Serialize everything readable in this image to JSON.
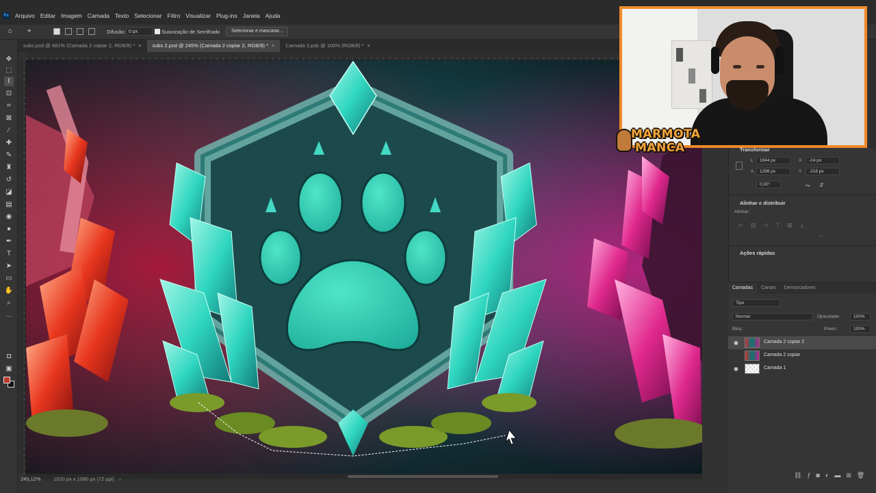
{
  "menu": [
    "Arquivo",
    "Editar",
    "Imagem",
    "Camada",
    "Texto",
    "Selecionar",
    "Filtro",
    "Visualizar",
    "Plug-ins",
    "Janela",
    "Ajuda"
  ],
  "options_bar": {
    "feather_label": "Difusão:",
    "feather_value": "0 px",
    "antialias_label": "Suavização de Serrilhado",
    "select_mask_button": "Selecionar e mascarar..."
  },
  "tabs": [
    {
      "label": "subs.psd @ 481% (Camada 2 copiar 2, RGB/8) *",
      "active": false
    },
    {
      "label": "subs 2.psd @ 245% (Camada 2 copiar 2, RGB/8) *",
      "active": true
    },
    {
      "label": "Camada 2.psb @ 100% (RGB/8) *",
      "active": false
    }
  ],
  "status": {
    "zoom": "245,12%",
    "dims": "1920 px x 1080 px (72 ppi)",
    "arrow": "›"
  },
  "brand": {
    "line1": "MARMOTA",
    "line2": "MANCA"
  },
  "properties": {
    "section_transform": "Transformar",
    "w_label": "L",
    "w_value": "1944 px",
    "h_label": "A",
    "h_value": "1296 px",
    "x_label": "X",
    "x_value": "-24 px",
    "y_label": "Y",
    "y_value": "-216 px",
    "angle_value": "0,00°",
    "section_align": "Alinhar e distribuir",
    "align_label": "Alinhar:",
    "more": "...",
    "section_quick": "Ações rápidas"
  },
  "layers_panel": {
    "tabs": [
      "Camadas",
      "Canais",
      "Demarcadores"
    ],
    "filter": "Tipo",
    "blend_mode": "Normal",
    "opacity_label": "Opacidade:",
    "opacity_value": "100%",
    "lock_label": "Bloq.:",
    "fill_label": "Preen.:",
    "fill_value": "100%",
    "layers": [
      {
        "name": "Camada 2 copiar 2",
        "visible": true,
        "selected": true
      },
      {
        "name": "Camada 2 copiar",
        "visible": false,
        "selected": false
      },
      {
        "name": "Camada 1",
        "visible": true,
        "selected": false
      }
    ]
  },
  "colors": {
    "accent_orange": "#f08a2a",
    "foreground_swatch": "#c0392b",
    "teal_gem": "#2fd6c0",
    "magenta_gem": "#e0288c"
  }
}
